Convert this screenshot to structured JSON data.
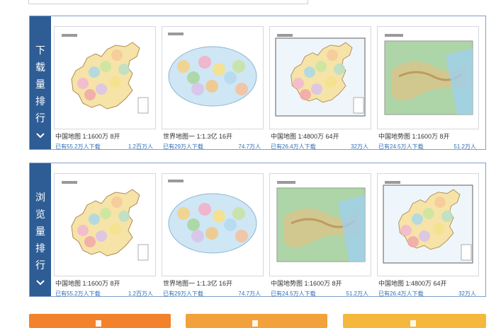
{
  "rankings": [
    {
      "title": [
        "下",
        "载",
        "量",
        "排",
        "行"
      ],
      "items": [
        {
          "name": "中国地图 1:1600万 8开",
          "downloads": "已有55.2万人下载",
          "views": "1.2百万人",
          "map": "china-admin"
        },
        {
          "name": "世界地图一 1:1.3亿 16开",
          "downloads": "已有29万人下载",
          "views": "74.7万人",
          "map": "world"
        },
        {
          "name": "中国地图 1:4800万 64开",
          "downloads": "已有26.4万人下载",
          "views": "32万人",
          "map": "china-admin-framed"
        },
        {
          "name": "中国地势图 1:1600万 8开",
          "downloads": "已有24.5万人下载",
          "views": "51.2万人",
          "map": "china-terrain"
        }
      ]
    },
    {
      "title": [
        "浏",
        "览",
        "量",
        "排",
        "行"
      ],
      "items": [
        {
          "name": "中国地图 1:1600万 8开",
          "downloads": "已有55.2万人下载",
          "views": "1.2百万人",
          "map": "china-admin"
        },
        {
          "name": "世界地图一 1:1.3亿 16开",
          "downloads": "已有29万人下载",
          "views": "74.7万人",
          "map": "world"
        },
        {
          "name": "中国地势图 1:1600万 8开",
          "downloads": "已有24.5万人下载",
          "views": "51.2万人",
          "map": "china-terrain"
        },
        {
          "name": "中国地图 1:4800万 64开",
          "downloads": "已有26.4万人下载",
          "views": "32万人",
          "map": "china-admin-framed"
        }
      ]
    }
  ],
  "icons": {
    "expand": "chevron-down-icon"
  }
}
